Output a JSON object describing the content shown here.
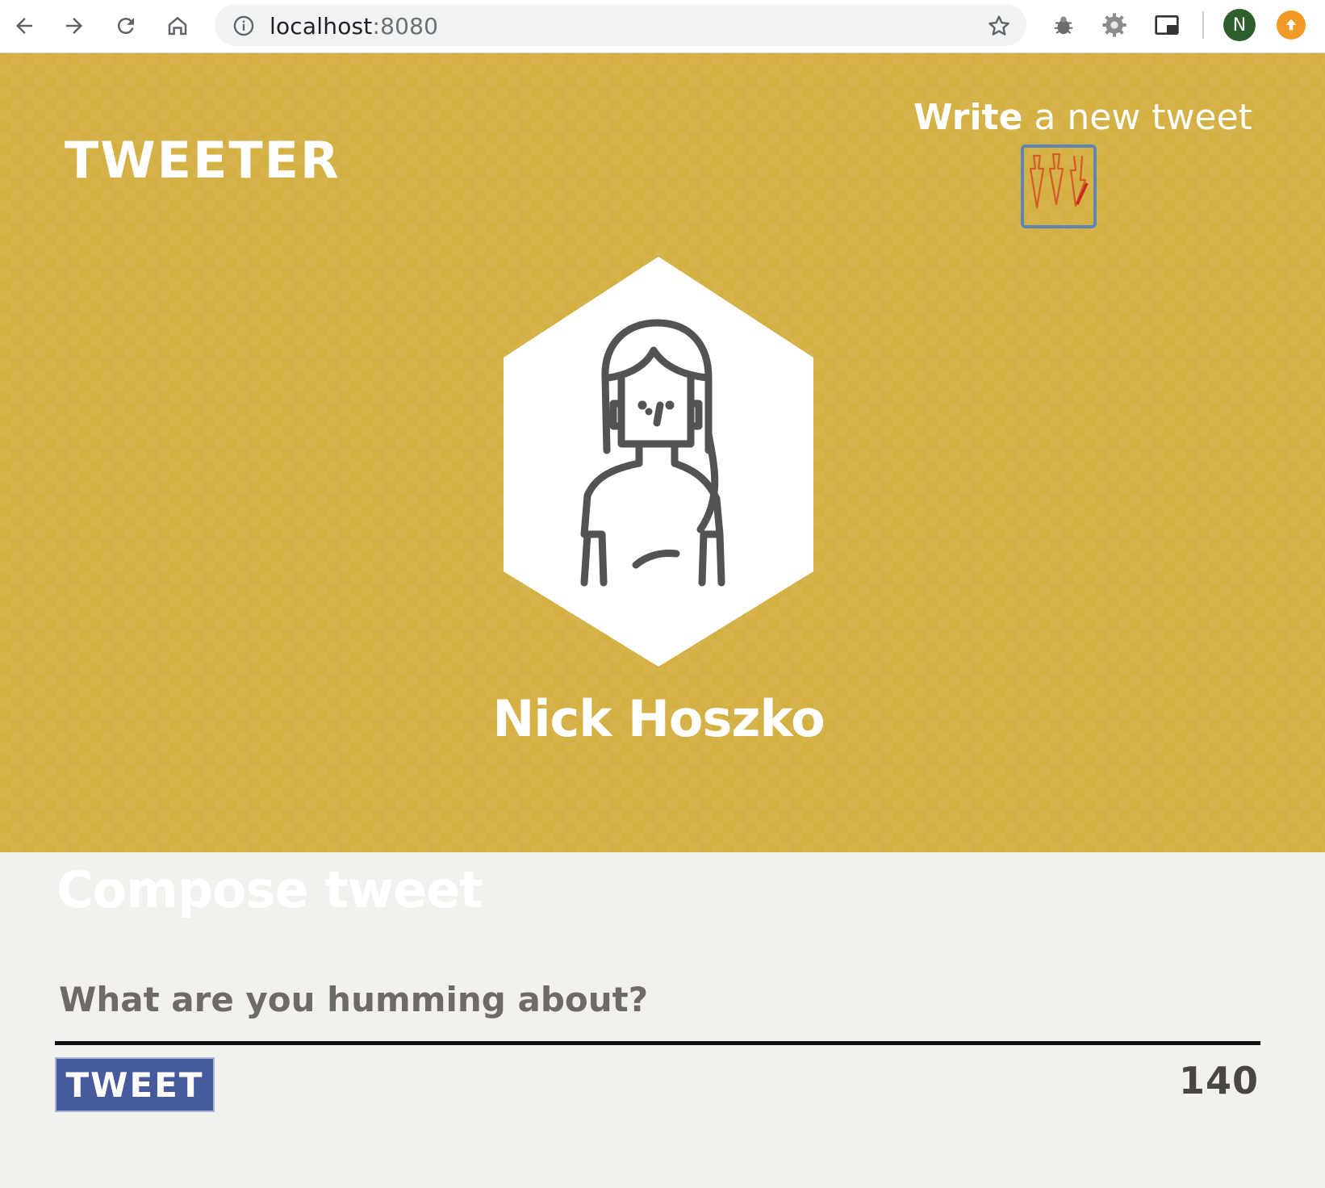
{
  "browser": {
    "url_host": "localhost",
    "url_port": ":8080",
    "profile_initial": "N",
    "icons": [
      "back-arrow-icon",
      "forward-arrow-icon",
      "reload-icon",
      "home-icon",
      "info-icon",
      "star-icon",
      "bug-extension-icon",
      "gear-extension-icon",
      "cast-icon",
      "update-icon"
    ],
    "colors": {
      "toolbar": "#ffffff",
      "omnibox": "#f1f3f4",
      "profile": "#2e5e2e",
      "update": "#f29a26"
    }
  },
  "header": {
    "brand": "TWEETER",
    "write_strong": "Write",
    "write_rest": " a new tweet",
    "write_icon": "down-arrows-icon"
  },
  "profile": {
    "name": "Nick Hoszko",
    "avatar_icon": "user-avatar-icon"
  },
  "compose": {
    "title": "Compose tweet",
    "placeholder": "What are you humming about?",
    "value": "",
    "button_label": "TWEET",
    "counter": "140"
  },
  "theme": {
    "hero_bg": "#d3b042",
    "page_bg": "#f3f1ed",
    "button_bg": "#475b9c",
    "text_dark": "#4a4643"
  }
}
